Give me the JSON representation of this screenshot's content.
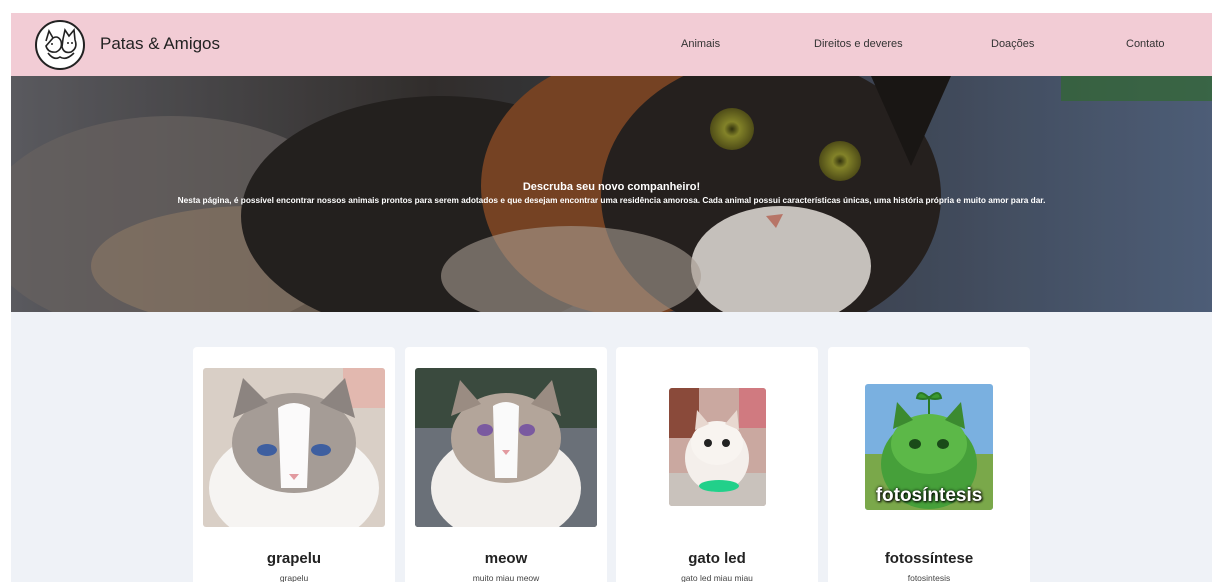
{
  "header": {
    "brand": "Patas & Amigos",
    "logo_icon": "cat-dog-logo-icon",
    "nav": [
      {
        "label": "Animais"
      },
      {
        "label": "Direitos e deveres"
      },
      {
        "label": "Doações"
      },
      {
        "label": "Contato"
      }
    ]
  },
  "hero": {
    "title": "Descruba seu novo companheiro!",
    "text": "Nesta página, é possível encontrar nossos animais prontos para serem adotados e que desejam encontrar uma residência amorosa. Cada animal possui características únicas, uma história própria e muito amor para dar."
  },
  "cards": [
    {
      "name": "grapelu",
      "desc": "grapelu"
    },
    {
      "name": "meow",
      "desc": "muito miau meow"
    },
    {
      "name": "gato led",
      "desc": "gato led miau miau"
    },
    {
      "name": "fotossíntese",
      "desc": "fotosintesis",
      "image_caption": "fotosíntesis"
    }
  ],
  "colors": {
    "header_bg": "#f2ccd5",
    "page_bg": "#eff2f7",
    "card_bg": "#ffffff"
  }
}
